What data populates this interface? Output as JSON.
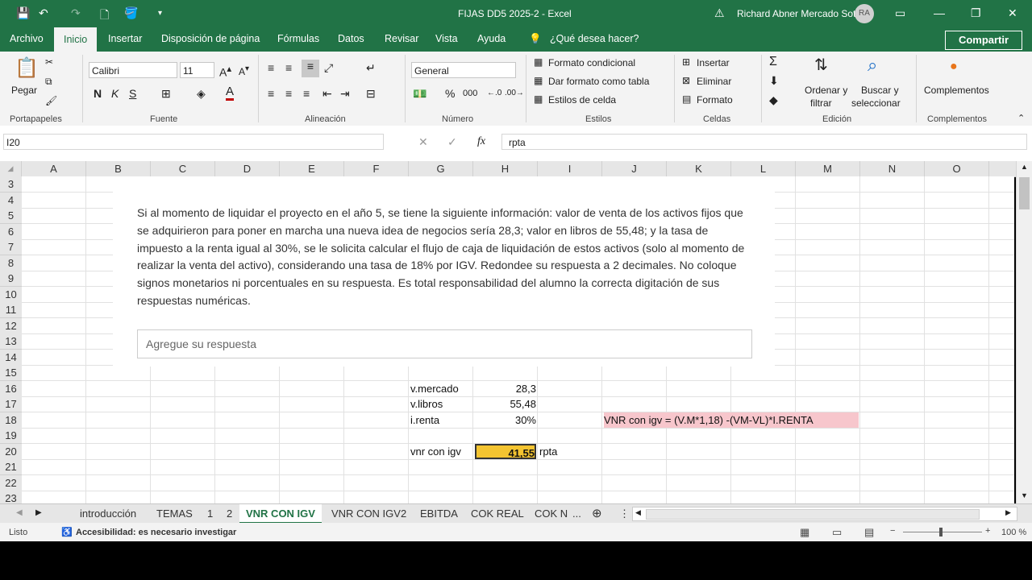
{
  "window": {
    "title": "FIJAS DD5 2025-2  -  Excel",
    "user_name": "Richard Abner Mercado Soto",
    "user_initials": "RA"
  },
  "ribbon_tabs": [
    "Archivo",
    "Inicio",
    "Insertar",
    "Disposición de página",
    "Fórmulas",
    "Datos",
    "Revisar",
    "Vista",
    "Ayuda"
  ],
  "tell_me": "¿Qué desea hacer?",
  "share_label": "Compartir",
  "ribbon": {
    "clipboard": {
      "paste": "Pegar",
      "group": "Portapapeles"
    },
    "font": {
      "name": "Calibri",
      "size": "11",
      "bold": "N",
      "italic": "K",
      "underline": "S",
      "group": "Fuente"
    },
    "alignment": {
      "group": "Alineación"
    },
    "number": {
      "format": "General",
      "group": "Número"
    },
    "styles": {
      "cond": "Formato condicional",
      "table": "Dar formato como tabla",
      "cell": "Estilos de celda",
      "group": "Estilos"
    },
    "cells": {
      "insert": "Insertar",
      "delete": "Eliminar",
      "format": "Formato",
      "group": "Celdas"
    },
    "editing": {
      "sort": "Ordenar y",
      "sort2": "filtrar",
      "find": "Buscar y",
      "find2": "seleccionar",
      "group": "Edición"
    },
    "addins": {
      "label": "Complementos",
      "group": "Complementos"
    }
  },
  "formula_bar": {
    "name_box": "I20",
    "formula": "rpta",
    "fx": "fx"
  },
  "columns": [
    "A",
    "B",
    "C",
    "D",
    "E",
    "F",
    "G",
    "H",
    "I",
    "J",
    "K",
    "L",
    "M",
    "N",
    "O"
  ],
  "rows": [
    "3",
    "4",
    "5",
    "6",
    "7",
    "8",
    "9",
    "10",
    "11",
    "12",
    "13",
    "14",
    "15",
    "16",
    "17",
    "18",
    "19",
    "20",
    "21",
    "22",
    "23"
  ],
  "question": {
    "text": "Si al momento de liquidar el proyecto en el año 5, se tiene la siguiente información: valor de venta de los activos fijos que se adquirieron para poner en marcha una nueva idea de negocios sería 28,3; valor en libros de 55,48; y la tasa de impuesto a la renta igual al 30%, se le solicita calcular el flujo de caja de liquidación de estos activos (solo al momento de realizar la venta del activo), considerando una tasa de 18% por IGV. Redondee su respuesta a 2 decimales. No coloque signos monetarios ni porcentuales en su respuesta. Es total responsabilidad del alumno la correcta digitación de sus respuestas numéricas.",
    "placeholder": "Agregue su respuesta"
  },
  "cells": {
    "g16": "v.mercado",
    "h16": "28,3",
    "g17": "v.libros",
    "h17": "55,48",
    "g18": "i.renta",
    "h18": "30%",
    "j18": "VNR con igv = (V.M*1,18) -(VM-VL)*I.RENTA",
    "g20": "vnr con igv",
    "h20": "41,55",
    "i20": "rpta"
  },
  "sheet_tabs": [
    "introducción",
    "TEMAS",
    "1",
    "2",
    "VNR CON IGV",
    "VNR CON IGV2",
    "EBITDA",
    "COK REAL",
    "COK N"
  ],
  "status": {
    "ready": "Listo",
    "accessibility": "Accesibilidad: es necesario investigar",
    "zoom": "100 %"
  },
  "colors": {
    "excel_green": "#217346",
    "highlight_yellow": "#f4c430",
    "formula_pink": "#f7c6cc"
  }
}
